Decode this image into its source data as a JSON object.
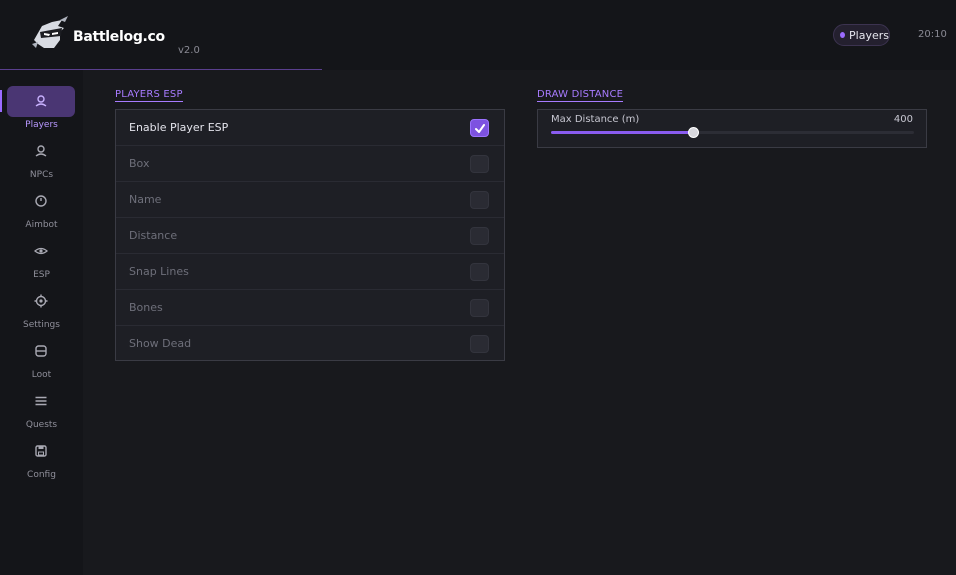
{
  "header": {
    "brand": "Battlelog.co",
    "version": "v2.0",
    "status_pill": "Players",
    "clock": "20:10",
    "accent_color": "#9b6bff"
  },
  "sidebar": {
    "items": [
      {
        "label": "Players",
        "icon": "user-icon",
        "active": true
      },
      {
        "label": "NPCs",
        "icon": "npc-icon",
        "active": false
      },
      {
        "label": "Aimbot",
        "icon": "crosshair-icon",
        "active": false
      },
      {
        "label": "ESP",
        "icon": "eye-icon",
        "active": false
      },
      {
        "label": "Settings",
        "icon": "gear-icon",
        "active": false
      },
      {
        "label": "Loot",
        "icon": "bag-icon",
        "active": false
      },
      {
        "label": "Quests",
        "icon": "list-icon",
        "active": false
      },
      {
        "label": "Config",
        "icon": "save-icon",
        "active": false
      }
    ]
  },
  "players_esp": {
    "title": "PLAYERS ESP",
    "options": [
      {
        "label": "Enable Player ESP",
        "checked": true
      },
      {
        "label": "Box",
        "checked": false
      },
      {
        "label": "Name",
        "checked": false
      },
      {
        "label": "Distance",
        "checked": false
      },
      {
        "label": "Snap Lines",
        "checked": false
      },
      {
        "label": "Bones",
        "checked": false
      },
      {
        "label": "Show Dead",
        "checked": false
      }
    ]
  },
  "draw_distance": {
    "title": "DRAW DISTANCE",
    "slider_label": "Max Distance (m)",
    "value": "400",
    "fill_fraction": 0.39
  }
}
